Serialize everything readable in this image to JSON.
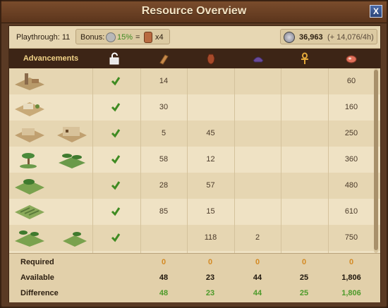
{
  "window": {
    "title": "Resource Overview",
    "close_label": "X"
  },
  "summary": {
    "playthrough": "Playthrough: 11",
    "bonus_label": "Bonus:",
    "bonus_percent": "15%",
    "bonus_equals": "=",
    "bonus_multiplier": "x4",
    "coins": "36,963",
    "coins_rate": "(+ 14,076/4h)"
  },
  "header": {
    "advancements": "Advancements",
    "icons": [
      "unlocked-padlock-icon",
      "papyrus-icon",
      "pottery-vase-icon",
      "purple-cloth-icon",
      "golden-ankh-icon",
      "raw-meat-icon"
    ]
  },
  "rows": [
    {
      "images": [
        "obelisk-quarry-icon"
      ],
      "check": true,
      "values": [
        "14",
        "",
        "",
        "",
        "60"
      ]
    },
    {
      "images": [
        "settlement-camp-icon"
      ],
      "check": true,
      "values": [
        "30",
        "",
        "",
        "",
        "160"
      ]
    },
    {
      "images": [
        "mudbrick-house-icon",
        "large-house-icon"
      ],
      "check": true,
      "values": [
        "5",
        "45",
        "",
        "",
        "250"
      ]
    },
    {
      "images": [
        "palm-tree-icon",
        "palm-garden-icon"
      ],
      "check": true,
      "values": [
        "58",
        "12",
        "",
        "",
        "360"
      ]
    },
    {
      "images": [
        "palm-field-icon"
      ],
      "check": true,
      "values": [
        "28",
        "57",
        "",
        "",
        "480"
      ]
    },
    {
      "images": [
        "crop-field-icon"
      ],
      "check": true,
      "values": [
        "85",
        "15",
        "",
        "",
        "610"
      ]
    },
    {
      "images": [
        "oasis-palms-icon",
        "small-palms-icon"
      ],
      "check": true,
      "values": [
        "",
        "118",
        "2",
        "",
        "750"
      ]
    }
  ],
  "footer": {
    "required_label": "Required",
    "available_label": "Available",
    "difference_label": "Difference",
    "required": [
      "0",
      "0",
      "0",
      "0",
      "0"
    ],
    "available": [
      "48",
      "23",
      "44",
      "25",
      "1,806"
    ],
    "difference": [
      "48",
      "23",
      "44",
      "25",
      "1,806"
    ]
  },
  "colors": {
    "required": "#d48a24",
    "difference": "#4c9a2a",
    "check": "#3f8b22"
  }
}
